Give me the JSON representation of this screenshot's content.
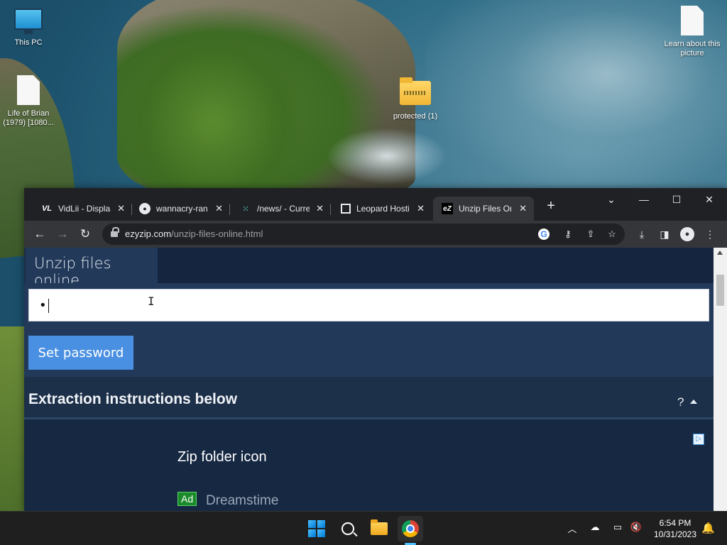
{
  "desktop": {
    "icons": [
      {
        "label": "This PC"
      },
      {
        "label": "Learn about this picture"
      },
      {
        "label": "Life of Brian (1979) [1080..."
      },
      {
        "label": "protected (1)"
      }
    ]
  },
  "browser": {
    "tabs": [
      {
        "title": "VidLii - Displa",
        "favicon": "VL",
        "active": false
      },
      {
        "title": "wannacry-ran",
        "favicon": "github-icon",
        "active": false
      },
      {
        "title": "/news/ - Curre",
        "favicon": "news-icon",
        "active": false
      },
      {
        "title": "Leopard Hosti",
        "favicon": "leopard-icon",
        "active": false
      },
      {
        "title": "Unzip Files Or",
        "favicon": "eZ",
        "active": true
      }
    ],
    "new_tab_label": "+",
    "url": {
      "domain": "ezyzip.com",
      "path": "/unzip-files-online.html"
    }
  },
  "page": {
    "section_tab": "Unzip files online",
    "password_value": "•",
    "set_password_label": "Set password",
    "instructions_title": "Extraction instructions below",
    "help_label": "?",
    "ad": {
      "choices_label": "▷",
      "heading": "Zip folder icon",
      "badge": "Ad",
      "advertiser": "Dreamstime"
    }
  },
  "taskbar": {
    "time": "6:54 PM",
    "date": "10/31/2023"
  },
  "colors": {
    "page_bg": "#1c2d45",
    "panel_bg": "#22395a",
    "button_blue": "#4a90e2",
    "chrome_dark": "#202124",
    "chrome_toolbar": "#35363a"
  }
}
